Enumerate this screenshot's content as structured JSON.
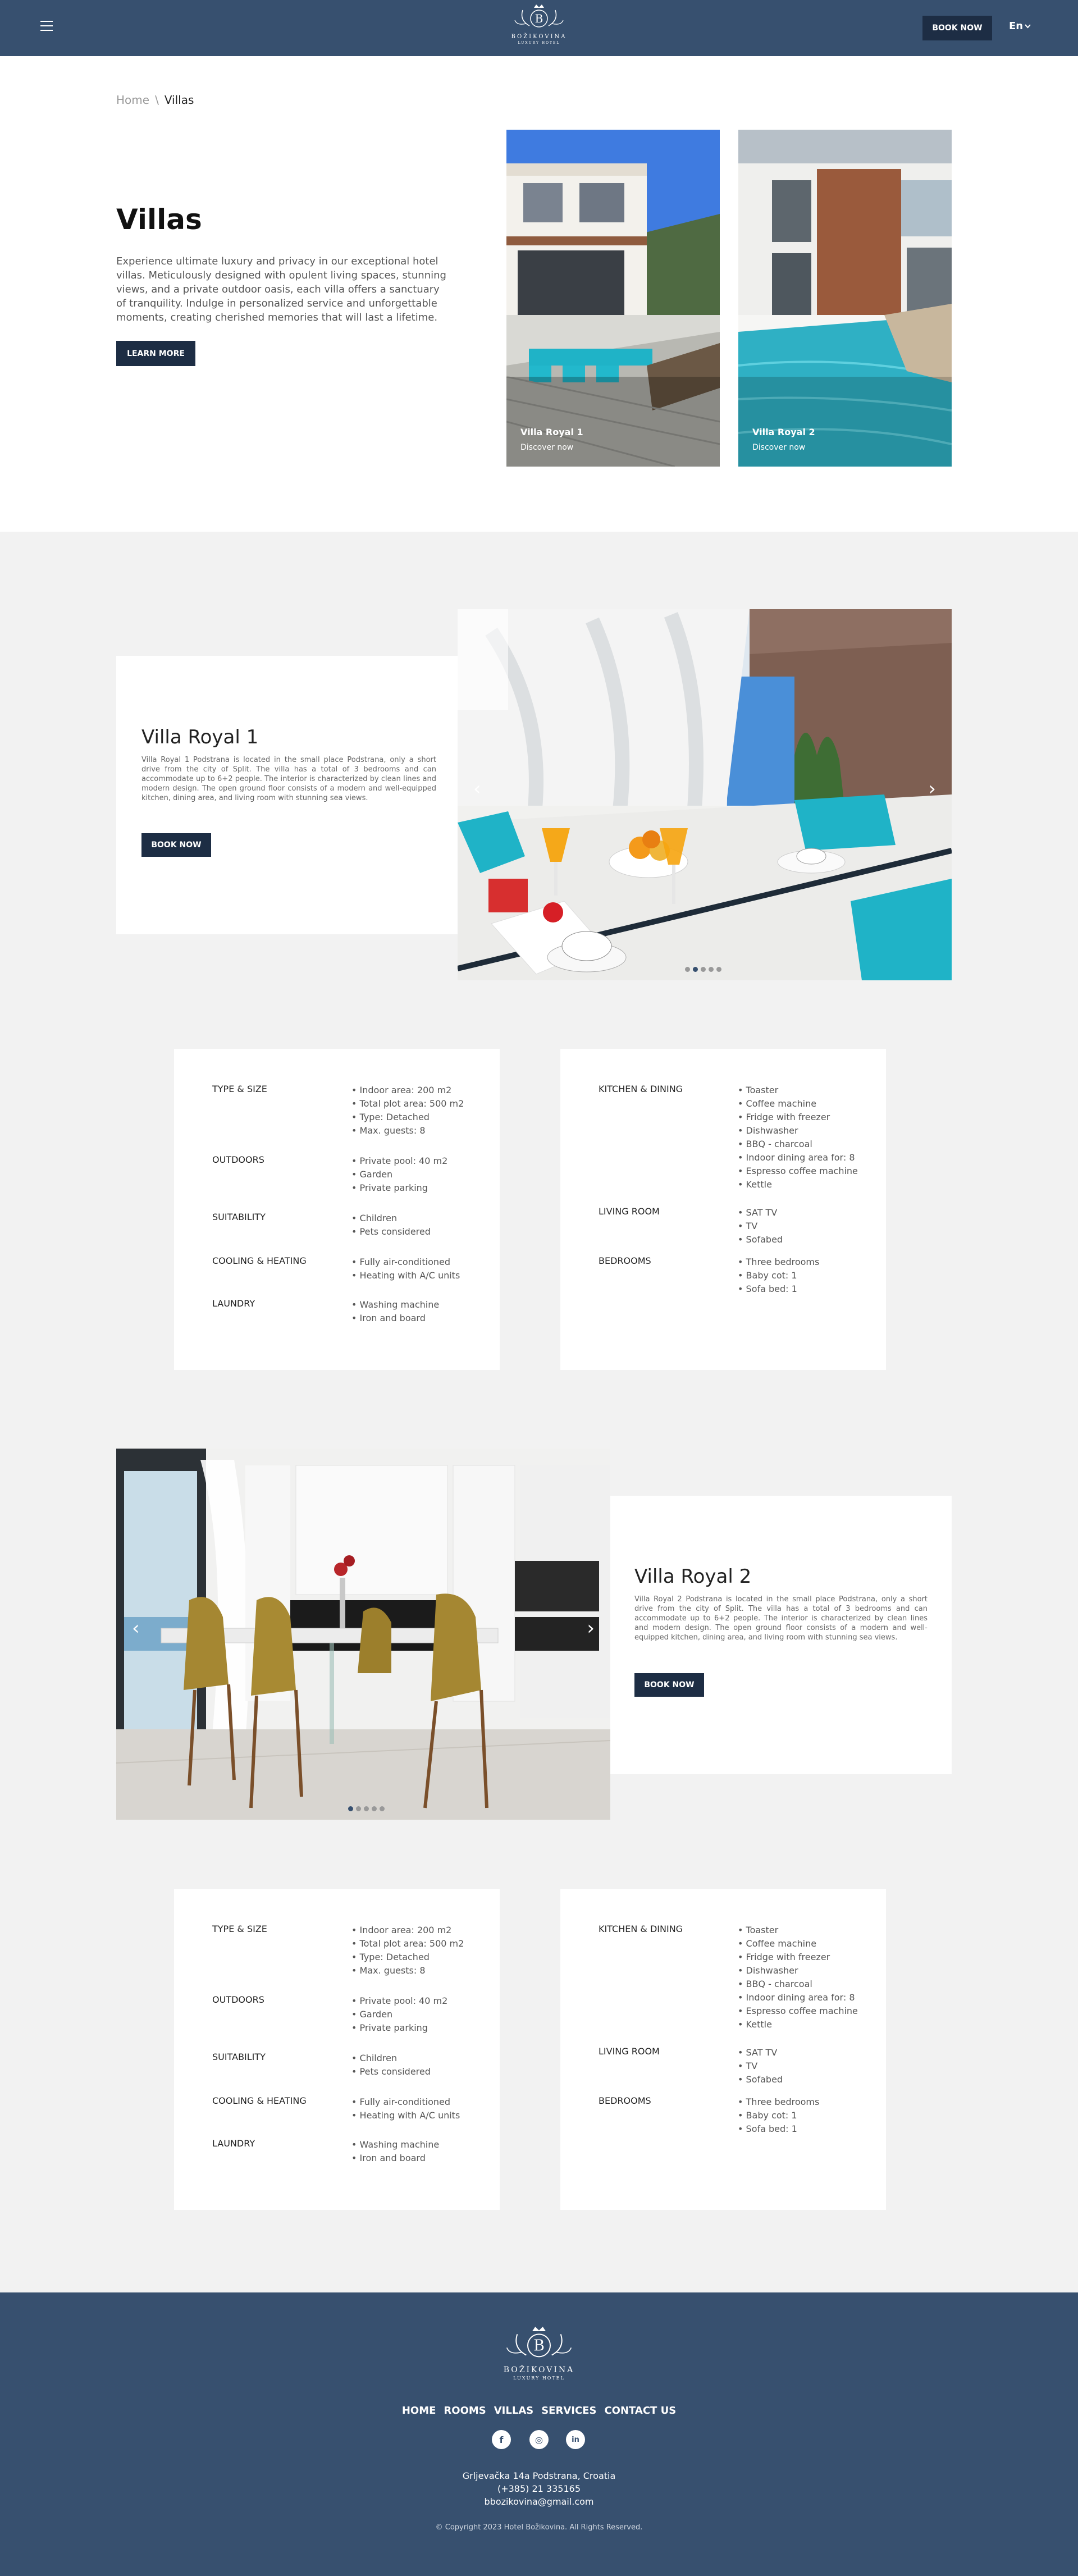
{
  "header": {
    "logo_text": "BOŽIKOVINA",
    "logo_sub": "LUXURY HOTEL",
    "logo_letter": "B",
    "book_now": "BOOK NOW",
    "language": "En"
  },
  "breadcrumb": {
    "home": "Home",
    "sep": "\\",
    "current": "Villas"
  },
  "intro": {
    "title": "Villas",
    "text": "Experience ultimate luxury and privacy in our exceptional hotel villas. Meticulously designed with opulent living spaces, stunning views, and a private outdoor oasis, each villa offers a sanctuary of tranquility. Indulge in personalized service and unforgettable moments, creating cherished memories that will last a lifetime.",
    "learn_more": "LEARN MORE"
  },
  "cards": [
    {
      "name": "Villa Royal 1",
      "sub": "Discover now"
    },
    {
      "name": "Villa Royal 2",
      "sub": "Discover now"
    }
  ],
  "villas": [
    {
      "name": "Villa Royal 1",
      "desc": "Villa Royal 1 Podstrana is located in the small place Podstrana, only a short drive from the city of Split. The villa has a total of 3 bedrooms and can accommodate up to 6+2 people. The interior is characterized by clean lines and modern design. The open ground floor consists of a modern and well-equipped kitchen, dining area, and living room with stunning sea views.",
      "book": "BOOK NOW",
      "prev": "‹",
      "next": "›"
    },
    {
      "name": "Villa Royal 2",
      "desc": "Villa Royal 2 Podstrana is located in the small place Podstrana, only a short drive from the city of Split. The villa has a total of 3 bedrooms and can accommodate up to 6+2 people. The interior is characterized by clean lines and modern design. The open ground floor consists of a modern and well-equipped kitchen, dining area, and living room with stunning sea views.",
      "book": "BOOK NOW",
      "prev": "‹",
      "next": "›"
    }
  ],
  "amenities": {
    "left": [
      {
        "label": "TYPE & SIZE",
        "items": [
          "Indoor area: 200 m2",
          "Total plot area: 500 m2",
          "Type: Detached",
          "Max. guests: 8"
        ]
      },
      {
        "label": "OUTDOORS",
        "items": [
          "Private pool: 40 m2",
          "Garden",
          "Private parking"
        ]
      },
      {
        "label": "SUITABILITY",
        "items": [
          "Children",
          "Pets considered"
        ]
      },
      {
        "label": "COOLING & HEATING",
        "items": [
          "Fully air-conditioned",
          "Heating with A/C units"
        ]
      },
      {
        "label": "LAUNDRY",
        "items": [
          "Washing machine",
          "Iron and board"
        ]
      }
    ],
    "right": [
      {
        "label": "KITCHEN & DINING",
        "items": [
          "Toaster",
          "Coffee machine",
          "Fridge with freezer",
          "Dishwasher",
          "BBQ - charcoal",
          "Indoor dining area for: 8",
          "Espresso coffee machine",
          "Kettle"
        ]
      },
      {
        "label": "LIVING ROOM",
        "items": [
          "SAT TV",
          "TV",
          "Sofabed"
        ]
      },
      {
        "label": "BEDROOMS",
        "items": [
          "Three bedrooms",
          "Baby cot: 1",
          "Sofa bed: 1"
        ]
      }
    ]
  },
  "footer": {
    "nav": [
      "HOME",
      "ROOMS",
      "VILLAS",
      "SERVICES",
      "CONTACT US"
    ],
    "social": [
      "f",
      "◎",
      "in"
    ],
    "address": "Grljevačka 14a Podstrana, Croatia",
    "phone": "(+385) 21 335165",
    "email": "bbozikovina@gmail.com",
    "copyright": "© Copyright 2023 Hotel Božikovina. All Rights Reserved."
  },
  "colors": {
    "header": "#37506f",
    "button": "#1d2d44",
    "background": "#f2f2f2"
  }
}
